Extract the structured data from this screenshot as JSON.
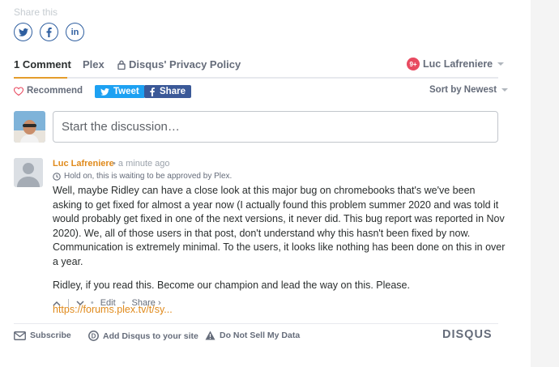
{
  "share": {
    "label": "Share this"
  },
  "tabs": {
    "comments": "1 Comment",
    "forum": "Plex",
    "privacy": "Disqus' Privacy Policy"
  },
  "user": {
    "name": "Luc Lafreniere",
    "notifications": "9+"
  },
  "actions": {
    "recommend": "Recommend",
    "tweet": "Tweet",
    "share": "Share",
    "sort": "Sort by Newest"
  },
  "composer": {
    "placeholder": "Start the discussion…"
  },
  "comment": {
    "author": "Luc Lafreniere",
    "time": "a minute ago",
    "pending": "Hold on, this is waiting to be approved by Plex.",
    "paragraphs": [
      "Well, maybe Ridley can have a close look at this major bug on chromebooks that's we've been asking to get fixed for almost a year now (I actually found this problem summer 2020 and was told it would probably get fixed in one of the next versions, it never did. This bug report was reported in Nov 2020). We, all of those users in that post, don't understand why this hasn't been fixed by now. Communication is extremely minimal. To the users, it looks like nothing has been done on this in over a year.",
      "Ridley, if you read this. Become our champion and lead the way on this. Please."
    ],
    "link": "https://forums.plex.tv/t/sy...",
    "edit": "Edit",
    "share": "Share ›",
    "separator": "|"
  },
  "footer": {
    "subscribe": "Subscribe",
    "add_disqus": "Add Disqus to your site",
    "do_not_sell": "Do Not Sell My Data",
    "logo": "DISQUS"
  },
  "colors": {
    "accent": "#e08a1b",
    "twitter": "#1da1f2",
    "facebook": "#3b5998",
    "notification": "#e84a60"
  }
}
